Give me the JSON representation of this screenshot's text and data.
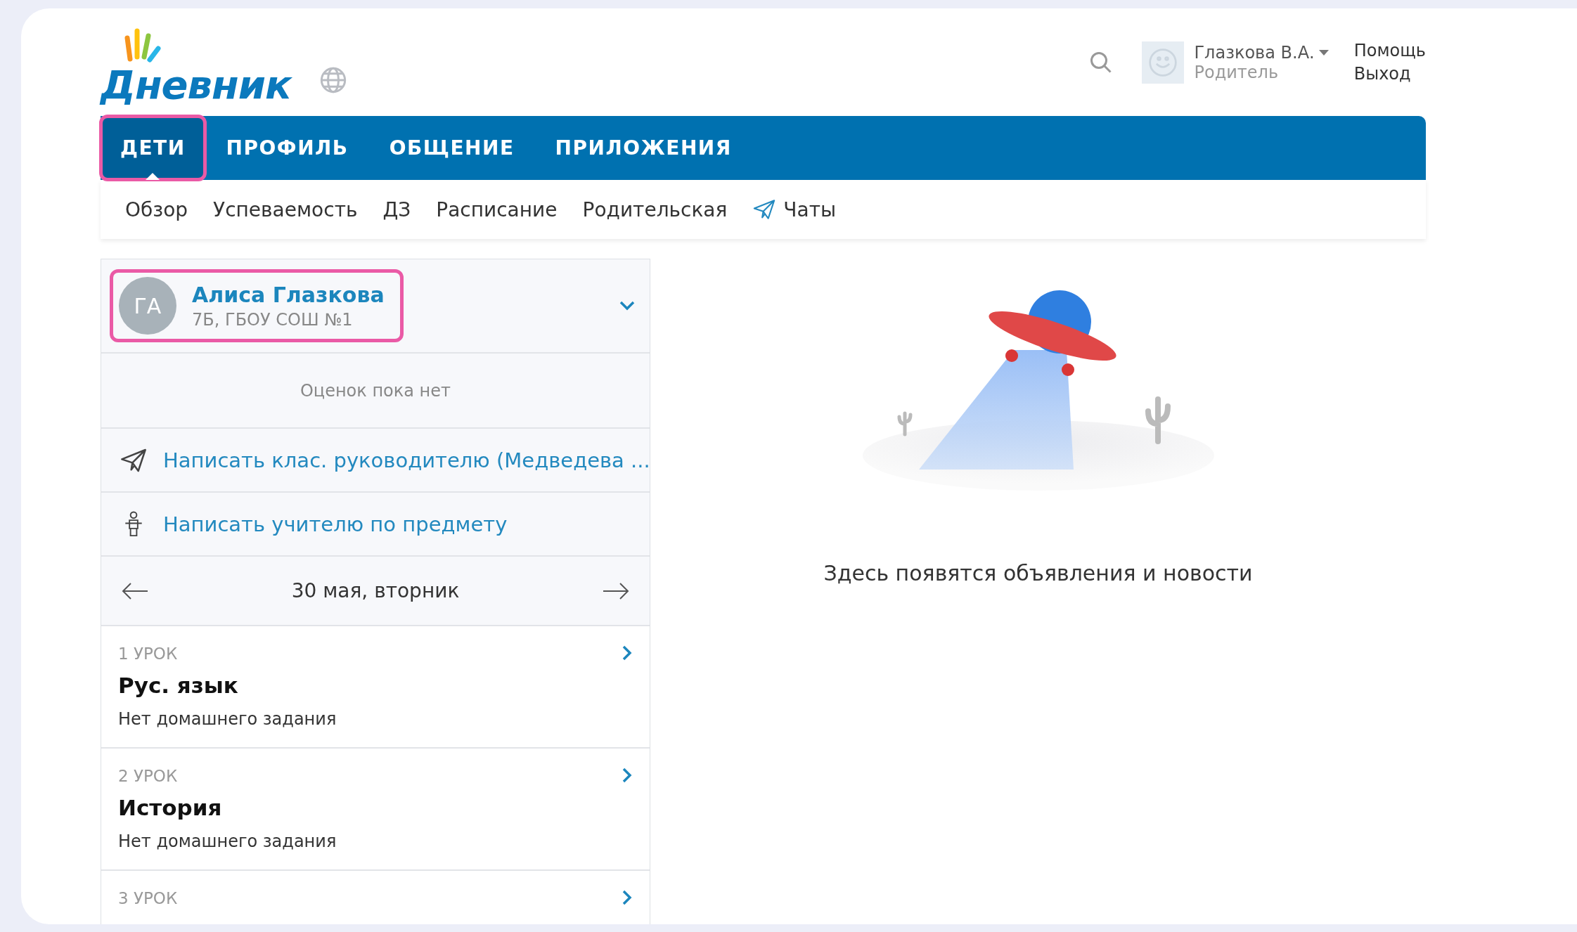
{
  "header": {
    "logo": "Дневник",
    "user": {
      "name": "Глазкова В.А.",
      "role": "Родитель"
    },
    "links": [
      "Помощь",
      "Выход"
    ]
  },
  "nav": {
    "tabs": [
      {
        "label": "ДЕТИ",
        "selected": true
      },
      {
        "label": "ПРОФИЛЬ",
        "selected": false
      },
      {
        "label": "ОБЩЕНИЕ",
        "selected": false
      },
      {
        "label": "ПРИЛОЖЕНИЯ",
        "selected": false
      }
    ]
  },
  "subnav": [
    {
      "label": "Обзор",
      "kind": "text"
    },
    {
      "label": "Успеваемость",
      "kind": "text"
    },
    {
      "label": "ДЗ",
      "kind": "text"
    },
    {
      "label": "Расписание",
      "kind": "text"
    },
    {
      "label": "Родительская",
      "kind": "text"
    },
    {
      "label": "Чаты",
      "kind": "plane"
    }
  ],
  "student": {
    "initials": "ГА",
    "name": "Алиса Глазкова",
    "school": "7Б, ГБОУ СОШ №1",
    "highlighted": true
  },
  "grades_note": "Оценок пока нет",
  "actions": [
    {
      "label": "Написать клас. руководителю (Медведева ...",
      "kind": "plane"
    },
    {
      "label": "Написать учителю по предмету",
      "kind": "person"
    }
  ],
  "date": "30 мая, вторник",
  "lessons": [
    {
      "number": "1 УРОК",
      "subject": "Рус. язык",
      "homework": "Нет домашнего задания"
    },
    {
      "number": "2 УРОК",
      "subject": "История",
      "homework": "Нет домашнего задания"
    },
    {
      "number": "3 УРОК"
    }
  ],
  "news": {
    "empty_text": "Здесь появятся объявления и новости"
  }
}
